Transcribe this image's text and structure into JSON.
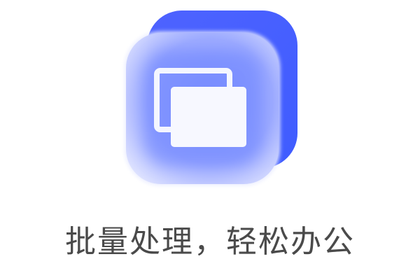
{
  "feature": {
    "icon_name": "batch-files-icon",
    "caption": "批量处理，轻松办公",
    "colors": {
      "back_tile": "#4a66ff",
      "glass_tile": "#8899ff",
      "card": "#f7f8ff",
      "caption_text": "#4a4a4a"
    }
  }
}
